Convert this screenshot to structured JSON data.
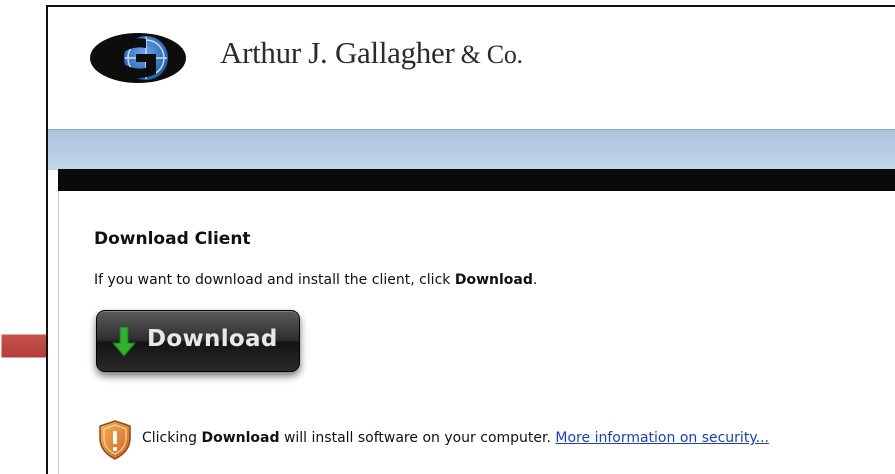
{
  "header": {
    "company_name": "Arthur J. Gallagher",
    "company_suffix": " & Co."
  },
  "main": {
    "section_title": "Download Client",
    "instruction_prefix": "If you want to download and install the client, click ",
    "instruction_bold": "Download",
    "instruction_suffix": ".",
    "download_button_label": "Download",
    "security_prefix": "Clicking ",
    "security_bold": "Download",
    "security_middle": " will install software on your computer. ",
    "security_link": "More information on security..."
  },
  "colors": {
    "accent_link": "#1a3fc4",
    "arrow_red": "#b9403c",
    "download_green": "#2fb32f",
    "band_blue": "#b3cbe2"
  },
  "icons": {
    "logo": "gallagher-globe-logo",
    "download": "down-arrow-icon",
    "security": "shield-warning-icon",
    "pointer": "red-pointer-arrow"
  }
}
